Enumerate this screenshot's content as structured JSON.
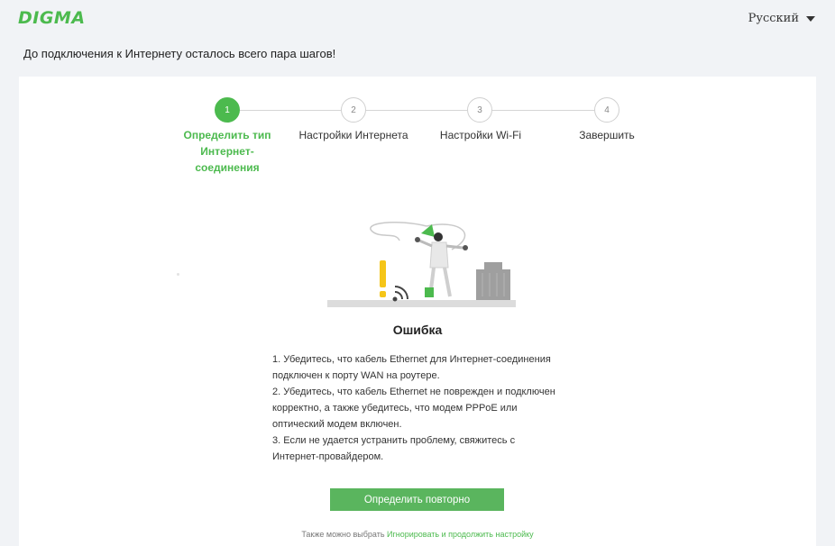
{
  "header": {
    "logo_text": "DIGMA",
    "language": "Русский"
  },
  "subtitle": "До подключения к Интернету осталось всего пара шагов!",
  "steps": [
    {
      "number": "1",
      "label": "Определить тип Интернет-соединения",
      "active": true
    },
    {
      "number": "2",
      "label": "Настройки Интернета",
      "active": false
    },
    {
      "number": "3",
      "label": "Настройки Wi-Fi",
      "active": false
    },
    {
      "number": "4",
      "label": "Завершить",
      "active": false
    }
  ],
  "error": {
    "title": "Ошибка",
    "lines": [
      "1. Убедитесь, что кабель Ethernet для Интернет-соединения",
      "подключен к порту WAN на роутере.",
      "2. Убедитесь, что кабель Ethernet не поврежден и подключен",
      "корректно, а также убедитесь, что модем PPPoE или",
      "оптический модем включен.",
      "3. Если не удается устранить проблему, свяжитесь с",
      "Интернет-провайдером."
    ]
  },
  "actions": {
    "retry_label": "Определить повторно",
    "skip_prefix": "Также можно выбрать ",
    "skip_link": "Игнорировать и продолжить настройку"
  },
  "colors": {
    "accent": "#4cba4e",
    "button": "#5ab55e",
    "warning": "#f5c518",
    "background": "#f1f3f6"
  }
}
